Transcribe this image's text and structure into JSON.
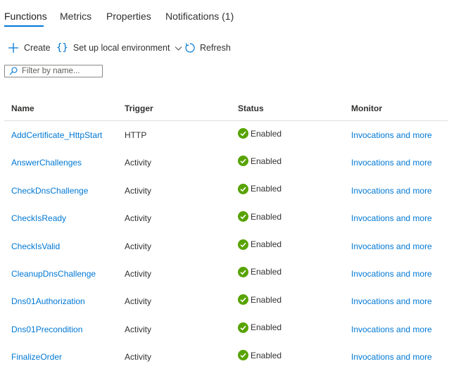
{
  "tabs": [
    {
      "label": "Functions",
      "active": true
    },
    {
      "label": "Metrics",
      "active": false
    },
    {
      "label": "Properties",
      "active": false
    },
    {
      "label": "Notifications (1)",
      "active": false
    }
  ],
  "toolbar": {
    "create_label": "Create",
    "setup_label": "Set up local environment",
    "refresh_label": "Refresh"
  },
  "filter": {
    "placeholder": "Filter by name...",
    "value": ""
  },
  "table": {
    "columns": [
      "Name",
      "Trigger",
      "Status",
      "Monitor"
    ],
    "rows": [
      {
        "name": "AddCertificate_HttpStart",
        "trigger": "HTTP",
        "status": "Enabled",
        "monitor": "Invocations and more"
      },
      {
        "name": "AnswerChallenges",
        "trigger": "Activity",
        "status": "Enabled",
        "monitor": "Invocations and more"
      },
      {
        "name": "CheckDnsChallenge",
        "trigger": "Activity",
        "status": "Enabled",
        "monitor": "Invocations and more"
      },
      {
        "name": "CheckIsReady",
        "trigger": "Activity",
        "status": "Enabled",
        "monitor": "Invocations and more"
      },
      {
        "name": "CheckIsValid",
        "trigger": "Activity",
        "status": "Enabled",
        "monitor": "Invocations and more"
      },
      {
        "name": "CleanupDnsChallenge",
        "trigger": "Activity",
        "status": "Enabled",
        "monitor": "Invocations and more"
      },
      {
        "name": "Dns01Authorization",
        "trigger": "Activity",
        "status": "Enabled",
        "monitor": "Invocations and more"
      },
      {
        "name": "Dns01Precondition",
        "trigger": "Activity",
        "status": "Enabled",
        "monitor": "Invocations and more"
      },
      {
        "name": "FinalizeOrder",
        "trigger": "Activity",
        "status": "Enabled",
        "monitor": "Invocations and more"
      }
    ]
  },
  "icons": {
    "create": "plus-icon",
    "setup": "braces-icon",
    "setup_dropdown": "chevron-down-icon",
    "refresh": "refresh-icon",
    "filter": "search-icon",
    "status": "check-circle-icon"
  },
  "colors": {
    "accent": "#0078d4",
    "status_ok": "#57a300",
    "text": "#323130",
    "divider": "#e1dfdd"
  }
}
